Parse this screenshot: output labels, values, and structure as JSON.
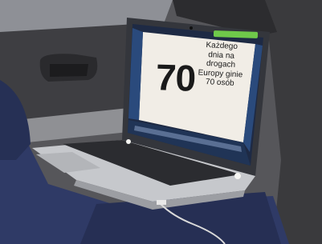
{
  "slide": {
    "number": "70",
    "lines": [
      "Każdego",
      "dnia na",
      "drogach",
      "Europy ginie",
      "70 osób"
    ]
  },
  "colors": {
    "slide_background": "#f1ede6",
    "badge": "#6fc94a",
    "laptop_body": "#b9bcc2",
    "car_interior": "#4a4a4e",
    "jacket": "#2f3a66"
  }
}
